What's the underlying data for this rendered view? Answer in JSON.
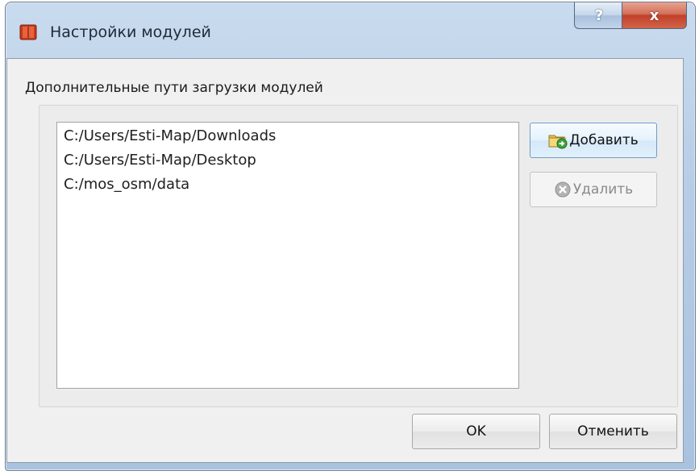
{
  "window": {
    "title": "Настройки модулей",
    "help_label": "?",
    "close_label": "x"
  },
  "section": {
    "label": "Дополнительные пути загрузки модулей"
  },
  "paths": [
    "C:/Users/Esti-Map/Downloads",
    "C:/Users/Esti-Map/Desktop",
    "C:/mos_osm/data"
  ],
  "side_buttons": {
    "add_label": "Добавить",
    "add_icon": "folder-add-icon",
    "delete_label": "Удалить",
    "delete_icon": "delete-icon",
    "delete_enabled": false
  },
  "footer": {
    "ok_label": "OK",
    "cancel_label": "Отменить"
  },
  "colors": {
    "close_button": "#c1412a",
    "help_button": "#a9bfdc",
    "primary_focus_border": "#6d9cc9"
  }
}
